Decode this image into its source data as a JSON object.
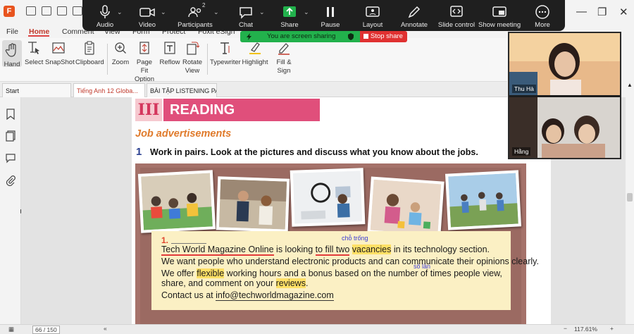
{
  "zoom_toolbar": {
    "items": [
      {
        "label": "Audio",
        "icon": "microphone-icon"
      },
      {
        "label": "Video",
        "icon": "video-camera-icon"
      },
      {
        "label": "Participants",
        "icon": "participants-icon",
        "count": "2"
      },
      {
        "label": "Chat",
        "icon": "chat-icon"
      },
      {
        "label": "Share",
        "icon": "share-screen-icon"
      },
      {
        "label": "Pause",
        "icon": "pause-icon"
      },
      {
        "label": "Layout",
        "icon": "layout-icon"
      },
      {
        "label": "Annotate",
        "icon": "pen-icon"
      },
      {
        "label": "Slide control",
        "icon": "slide-control-icon"
      },
      {
        "label": "Show meeting",
        "icon": "show-meeting-icon"
      },
      {
        "label": "More",
        "icon": "more-icon"
      }
    ],
    "share_color": "#22b14c"
  },
  "sharing_banner": {
    "status_text": "You are screen sharing",
    "stop_label": "Stop share",
    "green": "#22b14c",
    "red": "#e03131"
  },
  "menu": {
    "items": [
      "File",
      "Home",
      "Comment",
      "View",
      "Form",
      "Protect",
      "Foxit eSign"
    ],
    "active": "Home"
  },
  "ribbon": {
    "tools": [
      {
        "label": "Hand",
        "icon": "hand-icon"
      },
      {
        "label": "Select",
        "icon": "select-cursor-icon"
      },
      {
        "label": "SnapShot",
        "icon": "snapshot-icon"
      },
      {
        "label": "Clipboard",
        "icon": "clipboard-icon"
      },
      {
        "label": "Zoom",
        "icon": "zoom-icon"
      },
      {
        "label": "Page Fit Option",
        "icon": "page-fit-icon"
      },
      {
        "label": "Reflow",
        "icon": "reflow-icon"
      },
      {
        "label": "Rotate View",
        "icon": "rotate-view-icon"
      },
      {
        "label": "Typewriter",
        "icon": "typewriter-icon"
      },
      {
        "label": "Highlight",
        "icon": "highlight-icon"
      },
      {
        "label": "Fill & Sign",
        "icon": "fill-sign-icon"
      }
    ]
  },
  "tabs": [
    {
      "label": "Start"
    },
    {
      "label": "Tiếng Anh 12 Globa..."
    },
    {
      "label": "BÀI TẬP LISTENING PA..."
    }
  ],
  "document": {
    "section_number": "III",
    "section_title": "READING",
    "subheading": "Job advertisements",
    "exercise_number": "1",
    "exercise_instruction": "Work in pairs. Look at the pictures and discuss what you know about the jobs.",
    "ad_number": "1.",
    "ad_lines": [
      "Tech World Magazine Online",
      " is looking ",
      "to fill two",
      " ",
      "vacancies",
      " in its technology section.",
      "We want people who understand electronic products and can communicate their opinions clearly.",
      "We offer ",
      "flexible",
      " working hours and a bonus based on the number of times people view,",
      "share, and comment on your ",
      "reviews",
      ".",
      "Contact us at ",
      "info@techworldmagazine.com"
    ],
    "annotations": [
      "chỗ trống",
      "số lần"
    ],
    "title_pink": "#e04f7b",
    "highlight_yellow": "#ffe066"
  },
  "video_panel": {
    "participants": [
      "Thu Hà",
      "Hằng"
    ]
  },
  "status": {
    "page_indicator": "66 / 150",
    "zoom_level": "117.61%"
  }
}
